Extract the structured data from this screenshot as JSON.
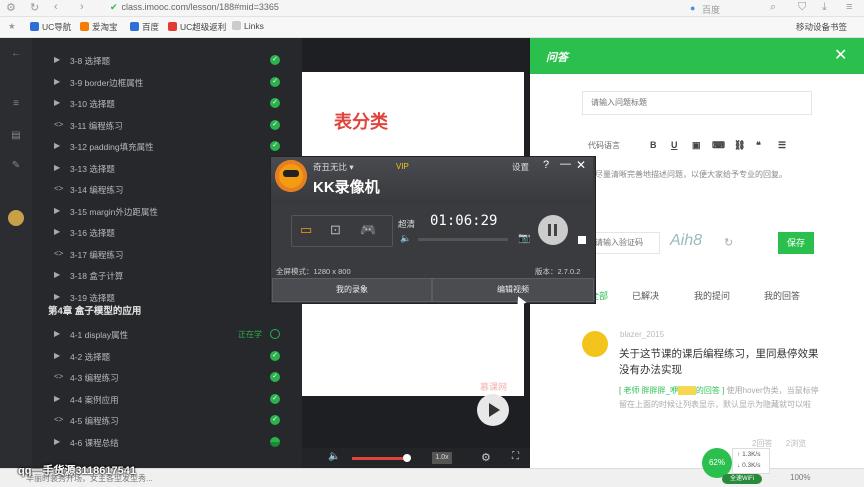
{
  "browser": {
    "url": "class.imooc.com/lesson/188#mid=3365",
    "search_engine": "百度",
    "bookmarks": [
      "UC导航",
      "爱淘宝",
      "百度",
      "UC超级返利",
      "Links"
    ],
    "mobile_bookmarks": "移动设备书签"
  },
  "sidebar": {
    "items": [
      {
        "icon": "expand",
        "label": "3-8 选择题",
        "done": true
      },
      {
        "icon": "expand",
        "label": "3-9 border边框属性",
        "done": true
      },
      {
        "icon": "expand",
        "label": "3-10 选择题",
        "done": true
      },
      {
        "icon": "code",
        "label": "3-11 编程练习",
        "done": true
      },
      {
        "icon": "expand",
        "label": "3-12 padding填充属性",
        "done": true
      },
      {
        "icon": "expand",
        "label": "3-13 选择题",
        "done": true
      },
      {
        "icon": "code",
        "label": "3-14 编程练习",
        "done": true
      },
      {
        "icon": "expand",
        "label": "3-15 margin外边距属性",
        "done": true
      },
      {
        "icon": "expand",
        "label": "3-16 选择题",
        "done": true
      },
      {
        "icon": "code",
        "label": "3-17 编程练习",
        "done": true
      },
      {
        "icon": "expand",
        "label": "3-18 盒子计算",
        "done": true
      },
      {
        "icon": "expand",
        "label": "3-19 选择题",
        "done": true
      }
    ],
    "chapter4": "第4章 盒子模型的应用",
    "items2": [
      {
        "icon": "expand",
        "label": "4-1 display属性",
        "status": "正在学"
      },
      {
        "icon": "expand",
        "label": "4-2 选择题",
        "done": true
      },
      {
        "icon": "code",
        "label": "4-3 编程练习",
        "done": true
      },
      {
        "icon": "expand",
        "label": "4-4 案例应用",
        "done": true
      },
      {
        "icon": "code",
        "label": "4-5 编程练习",
        "done": true
      },
      {
        "icon": "expand",
        "label": "4-6 课程总结",
        "done": "half"
      }
    ]
  },
  "video": {
    "slide_title": "表分类",
    "watermark": "慕课网",
    "speed": "1.0x"
  },
  "qa": {
    "title": "问答",
    "title_placeholder": "请输入问题标题",
    "toolbar_lang": "代码语言",
    "hint": "尽量清晰完善地描述问题，以便大家给予专业的回复。",
    "captcha_placeholder": "请输入验证码",
    "captcha_text": "Aih8",
    "save": "保存",
    "tabs": [
      "全部",
      "已解决",
      "我的提问",
      "我的回答"
    ],
    "question": {
      "user": "blazer_2015",
      "title": "关于这节课的课后编程练习，里同悬停效果没有办法实现",
      "answer_prefix": "[ 老师 胖胖胖_咿",
      "answer_tag": "的回答 ]",
      "answer_body": "使用hover伪类，当鼠标停留在上面的时候让列表显示，默认显示为隐藏就可以啦",
      "answers": "2回答",
      "views": "2浏览"
    }
  },
  "kk": {
    "user": "奇丑无比",
    "vip": "VIP",
    "name": "KK录像机",
    "settings": "设置",
    "quality": "超清",
    "time": "01:06:29",
    "fullscreen": "全屏模式：1280 x 800",
    "version": "版本：2.7.0.2",
    "btn_records": "我的录象",
    "btn_edit": "编辑视频"
  },
  "overlay": {
    "qq": "qq一手货源3118617541",
    "status_msg": "华丽时装秀开场，女主各型发型秀...",
    "net_pct": "62%",
    "up": "1.3K/s",
    "down": "0.3K/s",
    "speedup": "全速WiFi",
    "zoom": "100%"
  }
}
